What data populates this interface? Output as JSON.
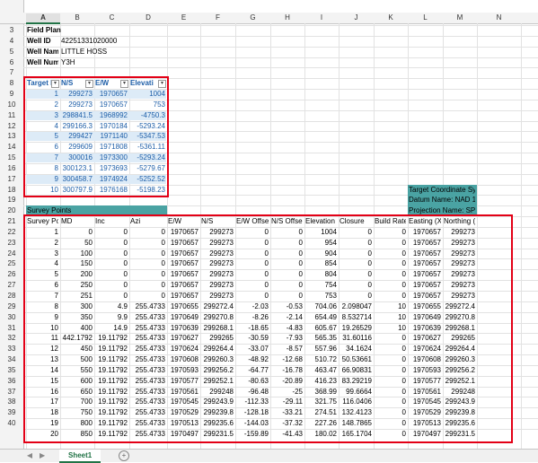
{
  "columns": [
    "A",
    "B",
    "C",
    "D",
    "E",
    "F",
    "G",
    "H",
    "I",
    "J",
    "K",
    "L",
    "M",
    "N"
  ],
  "row_numbers": [
    "3",
    "4",
    "5",
    "6",
    "7",
    "8",
    "9",
    "10",
    "11",
    "12",
    "13",
    "14",
    "15",
    "16",
    "17",
    "18",
    "19",
    "20",
    "21",
    "22",
    "23",
    "24",
    "25",
    "26",
    "27",
    "28",
    "29",
    "30",
    "31",
    "32",
    "33",
    "34",
    "35",
    "36",
    "37",
    "38",
    "39",
    "40"
  ],
  "header_info": {
    "field_plan": "Field Plan",
    "well_id_label": "Well ID",
    "well_id_value": "42251331020000",
    "well_name_label": "Well Nam",
    "well_name_value": "LITTLE HOSS",
    "well_num_label": "Well Num",
    "well_num_value": "Y3H"
  },
  "target_table": {
    "headers": [
      "Target I",
      "N/S",
      "E/W",
      "Elevati"
    ],
    "filter_icon": "filter-dropdown-icon",
    "rows": [
      [
        "1",
        "299273",
        "1970657",
        "1004"
      ],
      [
        "2",
        "299273",
        "1970657",
        "753"
      ],
      [
        "3",
        "298841.5",
        "1968992",
        "-4750.3"
      ],
      [
        "4",
        "299166.3",
        "1970184",
        "-5293.24"
      ],
      [
        "5",
        "299427",
        "1971140",
        "-5347.53"
      ],
      [
        "6",
        "299609",
        "1971808",
        "-5361.11"
      ],
      [
        "7",
        "300016",
        "1973300",
        "-5293.24"
      ],
      [
        "8",
        "300123.1",
        "1973693",
        "-5279.67"
      ],
      [
        "9",
        "300458.7",
        "1974924",
        "-5252.52"
      ],
      [
        "10",
        "300797.9",
        "1976168",
        "-5198.23"
      ]
    ]
  },
  "target_coordinate": {
    "title": "Target Coordinate Sy",
    "datum": "Datum Name: NAD 1",
    "projection": "Projection Name: SP"
  },
  "survey": {
    "title": "Survey Points",
    "headers": [
      "Survey Po",
      "MD",
      "Inc",
      "Azi",
      "E/W",
      "N/S",
      "E/W Offse",
      "N/S Offse",
      "Elevation",
      "Closure",
      "Build Rate",
      "Easting (X",
      "Northing (Y)"
    ],
    "rows": [
      [
        "1",
        "0",
        "0",
        "0",
        "1970657",
        "299273",
        "0",
        "0",
        "1004",
        "0",
        "0",
        "1970657",
        "299273"
      ],
      [
        "2",
        "50",
        "0",
        "0",
        "1970657",
        "299273",
        "0",
        "0",
        "954",
        "0",
        "0",
        "1970657",
        "299273"
      ],
      [
        "3",
        "100",
        "0",
        "0",
        "1970657",
        "299273",
        "0",
        "0",
        "904",
        "0",
        "0",
        "1970657",
        "299273"
      ],
      [
        "4",
        "150",
        "0",
        "0",
        "1970657",
        "299273",
        "0",
        "0",
        "854",
        "0",
        "0",
        "1970657",
        "299273"
      ],
      [
        "5",
        "200",
        "0",
        "0",
        "1970657",
        "299273",
        "0",
        "0",
        "804",
        "0",
        "0",
        "1970657",
        "299273"
      ],
      [
        "6",
        "250",
        "0",
        "0",
        "1970657",
        "299273",
        "0",
        "0",
        "754",
        "0",
        "0",
        "1970657",
        "299273"
      ],
      [
        "7",
        "251",
        "0",
        "0",
        "1970657",
        "299273",
        "0",
        "0",
        "753",
        "0",
        "0",
        "1970657",
        "299273"
      ],
      [
        "8",
        "300",
        "4.9",
        "255.4733",
        "1970655",
        "299272.4",
        "-2.03",
        "-0.53",
        "704.06",
        "2.098047",
        "10",
        "1970655",
        "299272.4"
      ],
      [
        "9",
        "350",
        "9.9",
        "255.4733",
        "1970649",
        "299270.8",
        "-8.26",
        "-2.14",
        "654.49",
        "8.532714",
        "10",
        "1970649",
        "299270.8"
      ],
      [
        "10",
        "400",
        "14.9",
        "255.4733",
        "1970639",
        "299268.1",
        "-18.65",
        "-4.83",
        "605.67",
        "19.26529",
        "10",
        "1970639",
        "299268.1"
      ],
      [
        "11",
        "442.1792",
        "19.11792",
        "255.4733",
        "1970627",
        "299265",
        "-30.59",
        "-7.93",
        "565.35",
        "31.60116",
        "0",
        "1970627",
        "299265"
      ],
      [
        "12",
        "450",
        "19.11792",
        "255.4733",
        "1970624",
        "299264.4",
        "-33.07",
        "-8.57",
        "557.96",
        "34.1624",
        "0",
        "1970624",
        "299264.4"
      ],
      [
        "13",
        "500",
        "19.11792",
        "255.4733",
        "1970608",
        "299260.3",
        "-48.92",
        "-12.68",
        "510.72",
        "50.53661",
        "0",
        "1970608",
        "299260.3"
      ],
      [
        "14",
        "550",
        "19.11792",
        "255.4733",
        "1970593",
        "299256.2",
        "-64.77",
        "-16.78",
        "463.47",
        "66.90831",
        "0",
        "1970593",
        "299256.2"
      ],
      [
        "15",
        "600",
        "19.11792",
        "255.4733",
        "1970577",
        "299252.1",
        "-80.63",
        "-20.89",
        "416.23",
        "83.29219",
        "0",
        "1970577",
        "299252.1"
      ],
      [
        "16",
        "650",
        "19.11792",
        "255.4733",
        "1970561",
        "299248",
        "-96.48",
        "-25",
        "368.99",
        "99.6664",
        "0",
        "1970561",
        "299248"
      ],
      [
        "17",
        "700",
        "19.11792",
        "255.4733",
        "1970545",
        "299243.9",
        "-112.33",
        "-29.11",
        "321.75",
        "116.0406",
        "0",
        "1970545",
        "299243.9"
      ],
      [
        "18",
        "750",
        "19.11792",
        "255.4733",
        "1970529",
        "299239.8",
        "-128.18",
        "-33.21",
        "274.51",
        "132.4123",
        "0",
        "1970529",
        "299239.8"
      ],
      [
        "19",
        "800",
        "19.11792",
        "255.4733",
        "1970513",
        "299235.6",
        "-144.03",
        "-37.32",
        "227.26",
        "148.7865",
        "0",
        "1970513",
        "299235.6"
      ],
      [
        "20",
        "850",
        "19.11792",
        "255.4733",
        "1970497",
        "299231.5",
        "-159.89",
        "-41.43",
        "180.02",
        "165.1704",
        "0",
        "1970497",
        "299231.5"
      ]
    ]
  },
  "sheet_tab": "Sheet1",
  "add_sheet_icon": "plus-circle-icon",
  "nav_left_icon": "arrow-left-icon",
  "nav_right_icon": "arrow-right-icon",
  "colors": {
    "highlight": "#e30016",
    "survey_band": "#4aa3a3",
    "table_band": "#ddebf7",
    "selected_header": "#217346"
  }
}
